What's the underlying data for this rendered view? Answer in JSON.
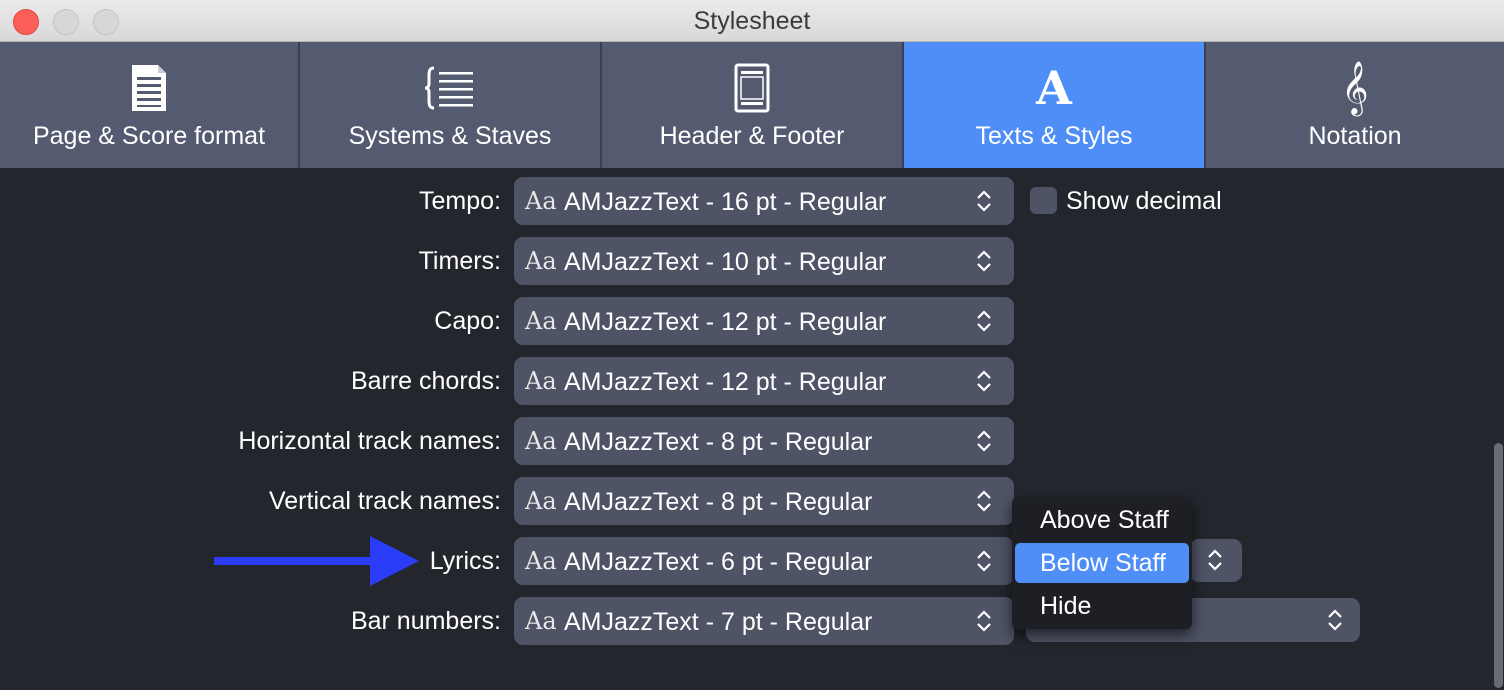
{
  "window": {
    "title": "Stylesheet"
  },
  "tabs": [
    {
      "label": "Page & Score format",
      "icon": "page-format-icon"
    },
    {
      "label": "Systems & Staves",
      "icon": "systems-staves-icon"
    },
    {
      "label": "Header & Footer",
      "icon": "header-footer-icon"
    },
    {
      "label": "Texts & Styles",
      "icon": "texts-styles-icon",
      "active": true
    },
    {
      "label": "Notation",
      "icon": "treble-clef-icon"
    }
  ],
  "texts_styles_icon_glyph": "A",
  "notation_icon_glyph": "𝄞",
  "font_preview": "Aa",
  "rows": [
    {
      "label": "Tempo:",
      "value": "AMJazzText - 16 pt - Regular"
    },
    {
      "label": "Timers:",
      "value": "AMJazzText - 10 pt - Regular"
    },
    {
      "label": "Capo:",
      "value": "AMJazzText - 12 pt - Regular"
    },
    {
      "label": "Barre chords:",
      "value": "AMJazzText - 12 pt - Regular"
    },
    {
      "label": "Horizontal track names:",
      "value": "AMJazzText - 8 pt - Regular"
    },
    {
      "label": "Vertical track names:",
      "value": "AMJazzText - 8 pt - Regular"
    },
    {
      "label": "Lyrics:",
      "value": "AMJazzText - 6 pt - Regular"
    },
    {
      "label": "Bar numbers:",
      "value": "AMJazzText - 7 pt - Regular"
    }
  ],
  "show_decimal": {
    "label": "Show decimal",
    "checked": false
  },
  "lyrics_position_menu": {
    "options": [
      "Above Staff",
      "Below Staff",
      "Hide"
    ],
    "selected": "Below Staff"
  },
  "colors": {
    "accent": "#4f8ef7",
    "annotation_arrow": "#2a3cf5"
  }
}
